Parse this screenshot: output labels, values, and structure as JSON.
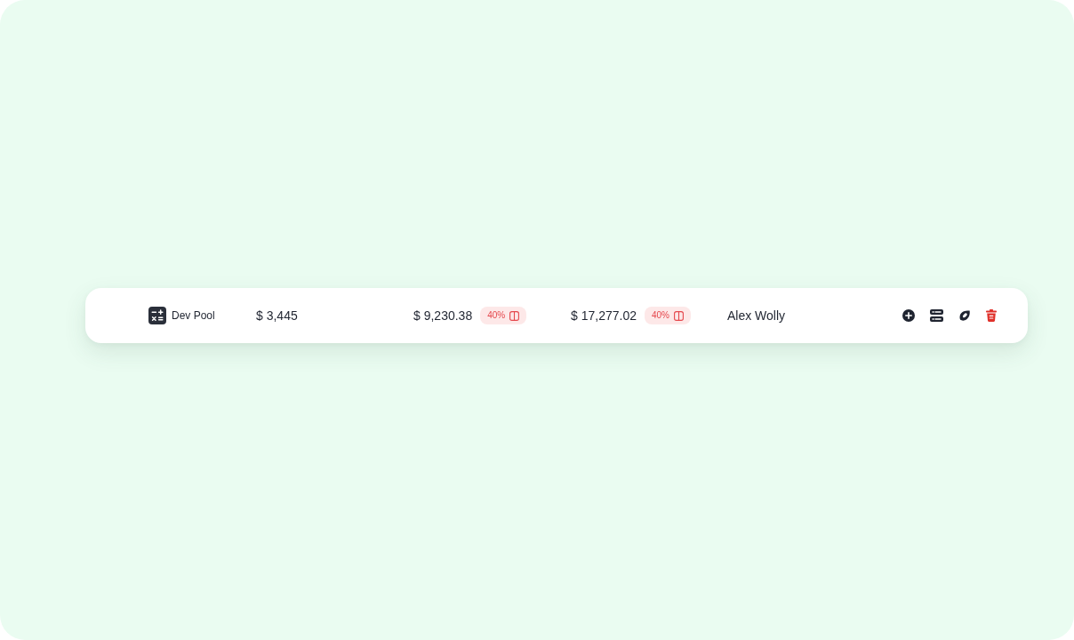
{
  "row": {
    "name": "Dev Pool",
    "column_2": "$ 3,445",
    "column_3": {
      "amount": "$ 9,230.38",
      "badge": "40%"
    },
    "column_4": {
      "amount": "$ 17,277.02",
      "badge": "40%"
    },
    "owner": "Alex Wolly",
    "actions": [
      {
        "kind": "add"
      },
      {
        "kind": "server"
      },
      {
        "kind": "leaf"
      },
      {
        "kind": "delete"
      }
    ]
  }
}
